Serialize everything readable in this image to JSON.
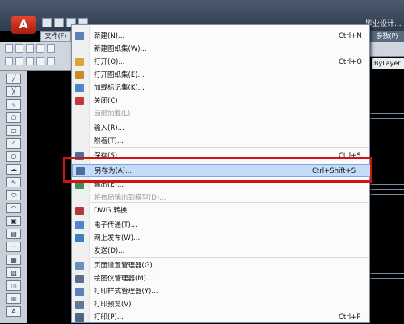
{
  "app": {
    "menu_button_label": "A",
    "file_tab": "文件(F)",
    "title_fragment": "毕业设计...",
    "params_tab": "参数(P)",
    "bylayer_label": "ByLayer"
  },
  "menu": {
    "items": [
      {
        "label": "新建(N)...",
        "shortcut": "Ctrl+N",
        "icon": "new-file-icon",
        "color": "#5b7fb8"
      },
      {
        "label": "新建图纸集(W)...",
        "shortcut": "",
        "icon": "",
        "color": ""
      },
      {
        "label": "打开(O)...",
        "shortcut": "Ctrl+O",
        "icon": "open-folder-icon",
        "color": "#d9a63a"
      },
      {
        "label": "打开图纸集(E)...",
        "shortcut": "",
        "icon": "open-sheetset-icon",
        "color": "#c98b2a"
      },
      {
        "label": "加载标记集(K)...",
        "shortcut": "",
        "icon": "markup-icon",
        "color": "#4f86c6"
      },
      {
        "label": "关闭(C)",
        "shortcut": "",
        "icon": "close-doc-icon",
        "color": "#c23b3b"
      },
      {
        "label": "局部加载(L)",
        "shortcut": "",
        "icon": "",
        "color": ""
      },
      {
        "label": "输入(R)...",
        "shortcut": "",
        "icon": "",
        "color": ""
      },
      {
        "label": "附着(T)...",
        "shortcut": "",
        "icon": "",
        "color": ""
      },
      {
        "label": "保存(S)",
        "shortcut": "Ctrl+S",
        "icon": "save-icon",
        "color": "#4a6e9e"
      },
      {
        "label": "另存为(A)...",
        "shortcut": "Ctrl+Shift+S",
        "icon": "save-as-icon",
        "color": "#4a6e9e"
      },
      {
        "label": "输出(E)...",
        "shortcut": "",
        "icon": "export-icon",
        "color": "#3f8f5a"
      },
      {
        "label": "将布局输出到模型(D)...",
        "shortcut": "",
        "icon": "",
        "color": ""
      },
      {
        "label": "DWG 转换",
        "shortcut": "",
        "icon": "dwg-convert-icon",
        "color": "#b03a3a"
      },
      {
        "label": "电子传递(T)...",
        "shortcut": "",
        "icon": "etransmit-icon",
        "color": "#4f86c6"
      },
      {
        "label": "网上发布(W)...",
        "shortcut": "",
        "icon": "publish-web-icon",
        "color": "#3b7fbf"
      },
      {
        "label": "发送(D)...",
        "shortcut": "",
        "icon": "",
        "color": ""
      },
      {
        "label": "页面设置管理器(G)...",
        "shortcut": "",
        "icon": "page-setup-icon",
        "color": "#6b8fb8"
      },
      {
        "label": "绘图仪管理器(M)...",
        "shortcut": "",
        "icon": "plotter-icon",
        "color": "#5b6f88"
      },
      {
        "label": "打印样式管理器(Y)...",
        "shortcut": "",
        "icon": "plot-style-icon",
        "color": "#5b7fb8"
      },
      {
        "label": "打印预览(V)",
        "shortcut": "",
        "icon": "print-preview-icon",
        "color": "#5f7a99"
      },
      {
        "label": "打印(P)...",
        "shortcut": "Ctrl+P",
        "icon": "print-icon",
        "color": "#4c6888"
      }
    ]
  }
}
